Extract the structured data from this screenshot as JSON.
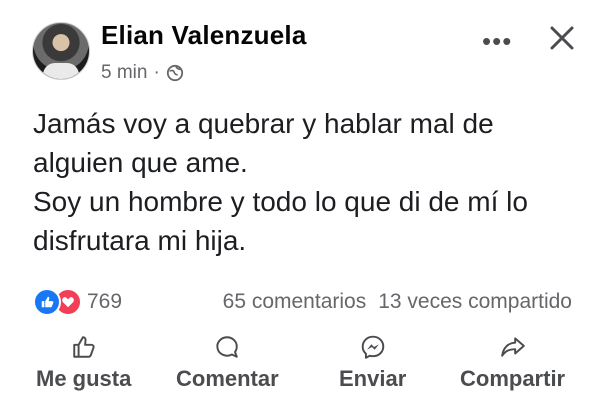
{
  "post": {
    "author": "Elian Valenzuela",
    "timestamp": "5 min",
    "separator": "·",
    "visibility_icon": "globe-icon",
    "text_lines": [
      "Jamás voy a quebrar y hablar mal de alguien que ame.",
      "Soy un hombre y todo lo que di de mí lo disfrutara mi hija."
    ]
  },
  "header": {
    "more_label": "•••",
    "close_icon": "close-icon"
  },
  "engagement": {
    "reaction_icons": [
      "like-icon",
      "love-icon"
    ],
    "reaction_count": "769",
    "comments": "65 comentarios",
    "shares": "13 veces compartido"
  },
  "actions": {
    "like": "Me gusta",
    "comment": "Comentar",
    "send": "Enviar",
    "share": "Compartir"
  },
  "colors": {
    "like_blue": "#1877f2",
    "love_red": "#f33e58",
    "secondary_text": "#65676b"
  }
}
